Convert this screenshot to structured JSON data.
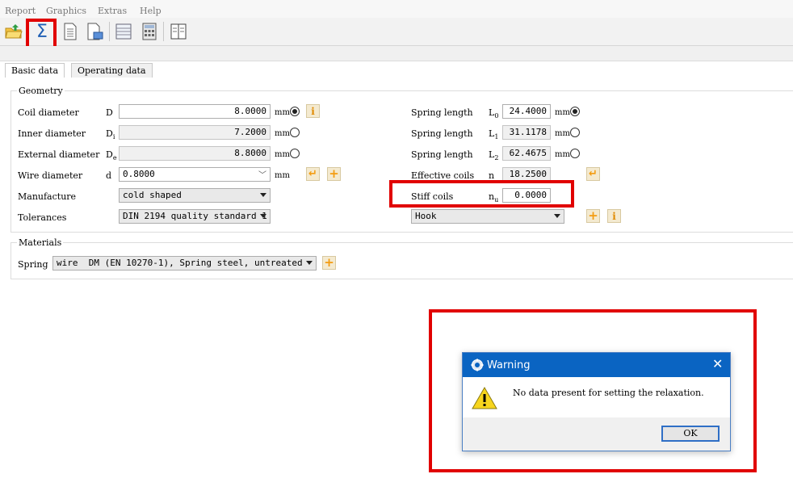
{
  "menu": {
    "report": "Report",
    "graphics": "Graphics",
    "extras": "Extras",
    "help": "Help"
  },
  "toolbar": {
    "sigma_label": "Σ"
  },
  "tabs": {
    "basic": "Basic data",
    "operating": "Operating data"
  },
  "geometry": {
    "title": "Geometry",
    "coil_diameter": {
      "label": "Coil diameter",
      "symbol": "D",
      "value": "8.0000",
      "unit": "mm"
    },
    "inner_diameter": {
      "label": "Inner diameter",
      "symbol": "D",
      "sub": "i",
      "value": "7.2000",
      "unit": "mm"
    },
    "external_diameter": {
      "label": "External diameter",
      "symbol": "D",
      "sub": "e",
      "value": "8.8000",
      "unit": "mm"
    },
    "wire_diameter": {
      "label": "Wire diameter",
      "symbol": "d",
      "value": "0.8000",
      "unit": "mm"
    },
    "manufacture": {
      "label": "Manufacture",
      "value": "cold shaped"
    },
    "tolerances": {
      "label": "Tolerances",
      "value": "DIN 2194 quality standard 1"
    },
    "spring_length_0": {
      "label": "Spring length",
      "symbol": "L",
      "sub": "0",
      "value": "24.4000",
      "unit": "mm"
    },
    "spring_length_1": {
      "label": "Spring length",
      "symbol": "L",
      "sub": "1",
      "value": "31.1178",
      "unit": "mm"
    },
    "spring_length_2": {
      "label": "Spring length",
      "symbol": "L",
      "sub": "2",
      "value": "62.4675",
      "unit": "mm"
    },
    "effective_coils": {
      "label": "Effective coils",
      "symbol": "n",
      "value": "18.2500"
    },
    "stiff_coils": {
      "label": "Stiff coils",
      "symbol": "n",
      "sub": "u",
      "value": "0.0000"
    },
    "end_type": {
      "value": "Hook"
    }
  },
  "materials": {
    "title": "Materials",
    "spring_label": "Spring",
    "spring_value": "wire  DM (EN 10270-1), Spring steel, untreated"
  },
  "dialog": {
    "title": "Warning",
    "message": "No data present for setting the relaxation.",
    "ok": "OK"
  },
  "colors": {
    "highlight": "#e10000",
    "accent": "#0a64c2"
  }
}
